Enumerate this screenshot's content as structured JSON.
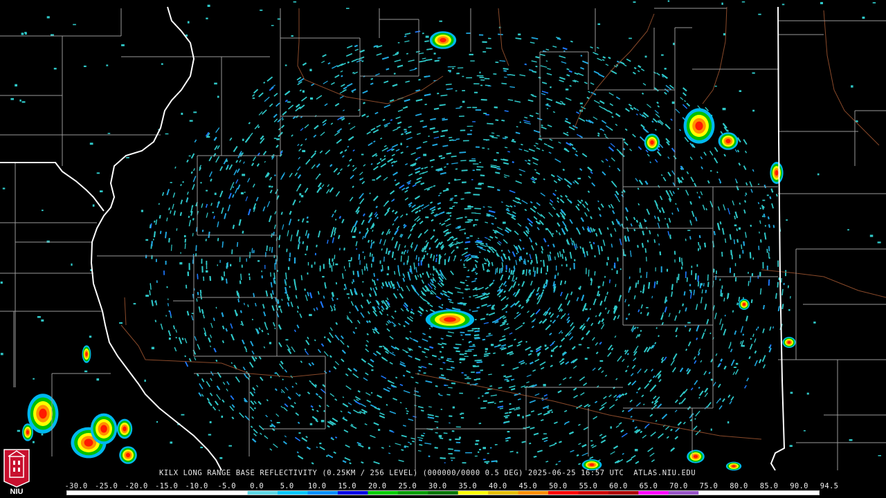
{
  "product": {
    "caption": "KILX LONG RANGE BASE REFLECTIVITY (0.25KM / 256 LEVEL) (000000/0000 0.5 DEG) 2025-06-25 16:57 UTC  ATLAS.NIU.EDU"
  },
  "colorbar": {
    "ticks": [
      "-30.0",
      "-25.0",
      "-20.0",
      "-15.0",
      "-10.0",
      "-5.0",
      "0.0",
      "5.0",
      "10.0",
      "15.0",
      "20.0",
      "25.0",
      "30.0",
      "35.0",
      "40.0",
      "45.0",
      "50.0",
      "55.0",
      "60.0",
      "65.0",
      "70.0",
      "75.0",
      "80.0",
      "85.0",
      "90.0",
      "94.5"
    ],
    "colors": [
      "#ffffff",
      "#ffffff",
      "#ffffff",
      "#ffffff",
      "#ffffff",
      "#ffffff",
      "#5fd9e8",
      "#00c8ff",
      "#0090ff",
      "#0000e8",
      "#00d000",
      "#00a000",
      "#007800",
      "#ffff00",
      "#e8c000",
      "#ff9000",
      "#ff0000",
      "#d00000",
      "#b00000",
      "#ff00ff",
      "#9955c9",
      "#ffffff",
      "#ffffff",
      "#ffffff",
      "#ffffff"
    ]
  },
  "logo": {
    "text": "NIU"
  },
  "colors": {
    "background": "#000000",
    "county_lines": "#9a9a9a",
    "state_lines": "#ffffff",
    "rivers": "#8a4a2a",
    "echo_weak": "#2fc8c8",
    "echo_moderate": "#1e78ff",
    "echo_strong": "#ff2a00"
  },
  "radar": {
    "site": "KILX"
  }
}
